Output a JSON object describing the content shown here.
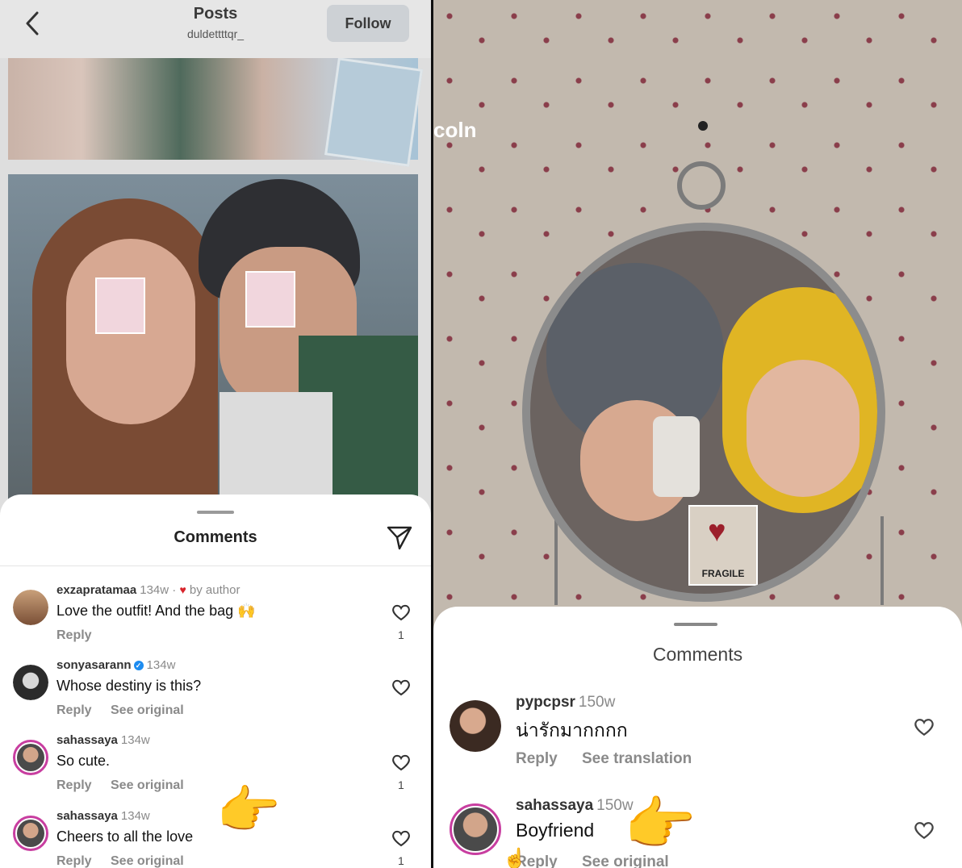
{
  "left": {
    "header": {
      "title": "Posts",
      "username": "duldettttqr_",
      "follow_label": "Follow"
    },
    "comments_title": "Comments",
    "comments": [
      {
        "username": "exzapratamaa",
        "time": "134w ·",
        "liked_by_author": "by author",
        "text": "Love the outfit! And the bag 🙌",
        "reply": "Reply",
        "likes": "1"
      },
      {
        "username": "sonyasarann",
        "verified": true,
        "time": "134w",
        "text": "Whose destiny is this?",
        "reply": "Reply",
        "see_original": "See original"
      },
      {
        "username": "sahassaya",
        "time": "134w",
        "text": "So cute.",
        "reply": "Reply",
        "see_original": "See original",
        "likes": "1"
      },
      {
        "username": "sahassaya",
        "time": "134w",
        "text": "Cheers to all the love",
        "reply": "Reply",
        "see_original": "See original",
        "likes": "1"
      }
    ],
    "pointer_emoji": "👉"
  },
  "right": {
    "overlay_text": "coln",
    "fragile_label": "FRAGILE",
    "comments_title": "Comments",
    "comments": [
      {
        "username": "pypcpsr",
        "time": "150w",
        "text": "น่ารักมากกกก",
        "reply": "Reply",
        "see_translation": "See translation"
      },
      {
        "username": "sahassaya",
        "time": "150w",
        "text": "Boyfriend",
        "reply": "Reply",
        "see_original": "See original"
      }
    ],
    "pointer_emoji": "👉"
  }
}
